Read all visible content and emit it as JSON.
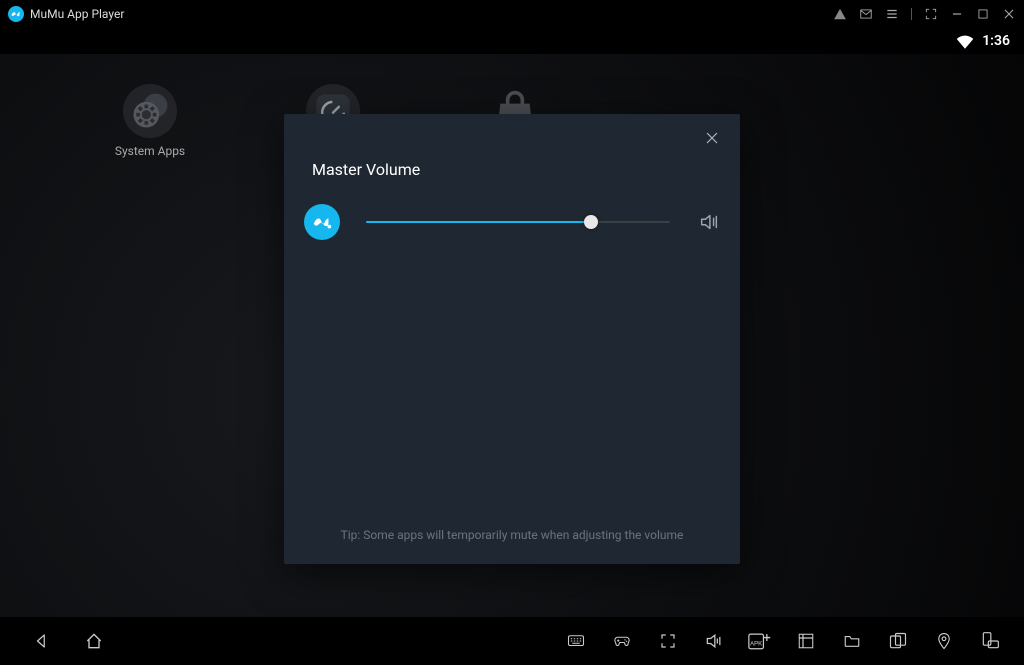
{
  "titlebar": {
    "app_name": "MuMu App Player"
  },
  "statusbar": {
    "time": "1:36"
  },
  "desktop": {
    "icons": {
      "system_apps_label": "System Apps"
    }
  },
  "modal": {
    "title": "Master Volume",
    "tip": "Tip: Some apps will temporarily mute when adjusting the volume",
    "slider_percent": 74
  },
  "colors": {
    "accent": "#16b7ee"
  }
}
